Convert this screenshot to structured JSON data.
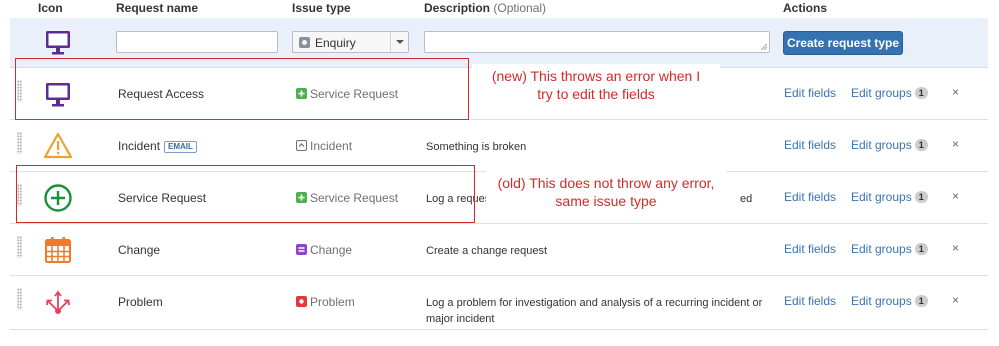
{
  "header": {
    "icon": "Icon",
    "request_name": "Request name",
    "issue_type": "Issue type",
    "description": "Description",
    "description_optional": "(Optional)",
    "actions": "Actions"
  },
  "create_row": {
    "name_value": "",
    "issue_type_selected": "Enquiry",
    "description_value": "",
    "create_button": "Create request type"
  },
  "rows": [
    {
      "icon": "monitor-icon",
      "name": "Request Access",
      "badge": "",
      "issue_type": "Service Request",
      "issue_icon": "plus-square-icon",
      "issue_color": "#4caf50",
      "description": "",
      "edit_fields": "Edit fields",
      "edit_groups": "Edit groups",
      "groups_count": "1",
      "delete": "×"
    },
    {
      "icon": "warning-icon",
      "name": "Incident",
      "badge": "EMAIL",
      "issue_type": "Incident",
      "issue_icon": "incident-icon",
      "issue_color": "#707070",
      "description": "Something is broken",
      "edit_fields": "Edit fields",
      "edit_groups": "Edit groups",
      "groups_count": "1",
      "delete": "×"
    },
    {
      "icon": "plus-circle-icon",
      "name": "Service Request",
      "badge": "",
      "issue_type": "Service Request",
      "issue_icon": "plus-square-icon",
      "issue_color": "#4caf50",
      "description": "Log a reques",
      "description_tail": "ed",
      "edit_fields": "Edit fields",
      "edit_groups": "Edit groups",
      "groups_count": "1",
      "delete": "×"
    },
    {
      "icon": "calendar-icon",
      "name": "Change",
      "badge": "",
      "issue_type": "Change",
      "issue_icon": "change-icon",
      "issue_color": "#8e44c8",
      "description": "Create a change request",
      "edit_fields": "Edit fields",
      "edit_groups": "Edit groups",
      "groups_count": "1",
      "delete": "×"
    },
    {
      "icon": "network-icon",
      "name": "Problem",
      "badge": "",
      "issue_type": "Problem",
      "issue_icon": "problem-icon",
      "issue_color": "#e03a3a",
      "description": "Log a problem for investigation and analysis of a recurring incident or major incident",
      "edit_fields": "Edit fields",
      "edit_groups": "Edit groups",
      "groups_count": "1",
      "delete": "×"
    }
  ],
  "annotations": {
    "new_note_line1": "(new) This throws an error when I",
    "new_note_line2": "try to edit the fields",
    "old_note_line1": "(old) This does not throw any error,",
    "old_note_line2": "same issue type",
    "color": "#d42a2a"
  },
  "colors": {
    "primary": "#3572b0",
    "link": "#3b73af",
    "create_row_bg": "#e9f0fa",
    "monitor": "#5c2d91",
    "warning": "#f0a030",
    "service": "#1a8f3c",
    "calendar": "#f07a2a",
    "problem": "#e8405a"
  }
}
